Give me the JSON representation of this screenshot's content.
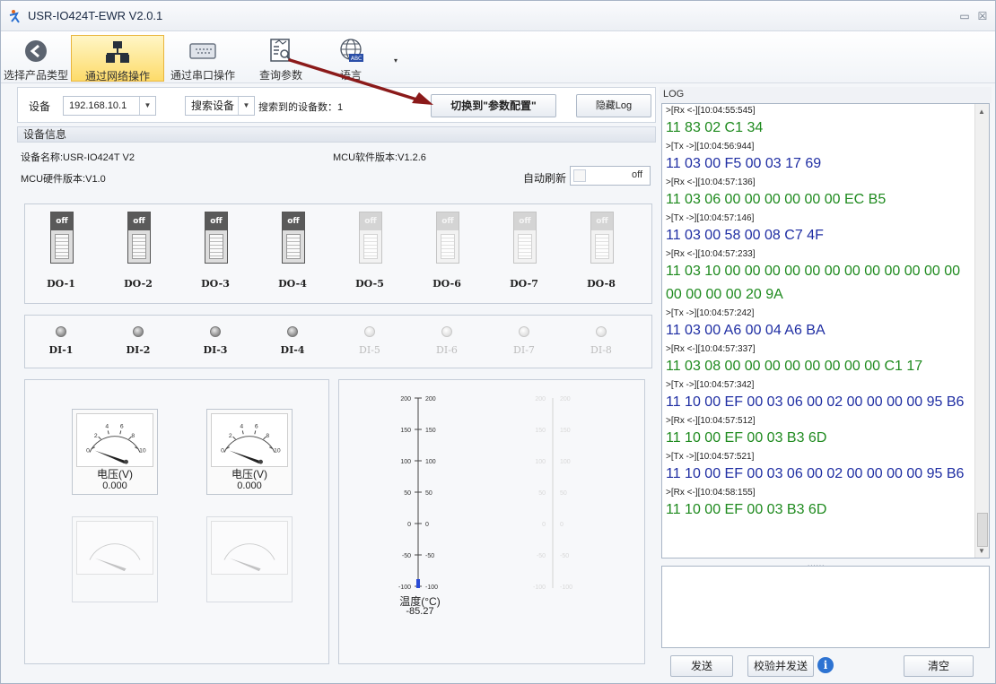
{
  "window": {
    "title": "USR-IO424T-EWR V2.0.1",
    "minimize": "▭",
    "close": "☒"
  },
  "toolbar": {
    "items": [
      {
        "label": "选择产品类型",
        "icon": "back-arrow-icon"
      },
      {
        "label": "通过网络操作",
        "icon": "network-icon",
        "active": true
      },
      {
        "label": "通过串口操作",
        "icon": "serial-port-icon"
      },
      {
        "label": "查询参数",
        "icon": "query-params-icon"
      },
      {
        "label": "语言",
        "icon": "globe-language-icon"
      }
    ],
    "dropdown": "▾"
  },
  "device_bar": {
    "device_label": "设备",
    "device_value": "192.168.10.1",
    "search_button": "搜索设备",
    "found_label": "搜索到的设备数：1",
    "switch_button": "切换到\"参数配置\"",
    "hide_log_button": "隐藏Log"
  },
  "device_info": {
    "section_title": "设备信息",
    "name": "设备名称:USR-IO424T V2",
    "mcu_software": "MCU软件版本:V1.2.6",
    "mcu_hardware": "MCU硬件版本:V1.0",
    "auto_refresh_label": "自动刷新",
    "auto_refresh_state": "off"
  },
  "digital_outputs": [
    {
      "label": "DO-1",
      "state": "off",
      "enabled": true
    },
    {
      "label": "DO-2",
      "state": "off",
      "enabled": true
    },
    {
      "label": "DO-3",
      "state": "off",
      "enabled": true
    },
    {
      "label": "DO-4",
      "state": "off",
      "enabled": true
    },
    {
      "label": "DO-5",
      "state": "off",
      "enabled": false
    },
    {
      "label": "DO-6",
      "state": "off",
      "enabled": false
    },
    {
      "label": "DO-7",
      "state": "off",
      "enabled": false
    },
    {
      "label": "DO-8",
      "state": "off",
      "enabled": false
    }
  ],
  "digital_inputs": [
    {
      "label": "DI-1",
      "enabled": true
    },
    {
      "label": "DI-2",
      "enabled": true
    },
    {
      "label": "DI-3",
      "enabled": true
    },
    {
      "label": "DI-4",
      "enabled": true
    },
    {
      "label": "DI-5",
      "enabled": false
    },
    {
      "label": "DI-6",
      "enabled": false
    },
    {
      "label": "DI-7",
      "enabled": false
    },
    {
      "label": "DI-8",
      "enabled": false
    }
  ],
  "gauges": [
    {
      "label": "电压(V)",
      "value": "0.000",
      "enabled": true
    },
    {
      "label": "电压(V)",
      "value": "0.000",
      "enabled": true
    },
    {
      "label": "",
      "value": "",
      "enabled": false
    },
    {
      "label": "",
      "value": "",
      "enabled": false
    }
  ],
  "gauge_scale": [
    "0",
    "2",
    "4",
    "6",
    "8",
    "10"
  ],
  "thermometer": {
    "label": "温度(°C)",
    "value": "-85.27",
    "ticks": [
      "200",
      "150",
      "100",
      "50",
      "0",
      "-50",
      "-100"
    ]
  },
  "log": {
    "title": "LOG",
    "lines": [
      {
        "kind": "meta",
        "text": ">[Rx <-][10:04:55:545]"
      },
      {
        "kind": "rx",
        "text": "11 83 02 C1 34"
      },
      {
        "kind": "meta",
        "text": ">[Tx ->][10:04:56:944]"
      },
      {
        "kind": "tx",
        "text": "11 03 00 F5 00 03 17 69"
      },
      {
        "kind": "meta",
        "text": ">[Rx <-][10:04:57:136]"
      },
      {
        "kind": "rx",
        "text": "11 03 06 00 00 00 00 00 00 EC B5"
      },
      {
        "kind": "meta",
        "text": ">[Tx ->][10:04:57:146]"
      },
      {
        "kind": "tx",
        "text": "11 03 00 58 00 08 C7 4F"
      },
      {
        "kind": "meta",
        "text": ">[Rx <-][10:04:57:233]"
      },
      {
        "kind": "rx",
        "text": "11 03 10 00 00 00 00 00 00 00 00 00 00 00 00"
      },
      {
        "kind": "rx",
        "text": "00 00 00 00 20 9A"
      },
      {
        "kind": "meta",
        "text": ">[Tx ->][10:04:57:242]"
      },
      {
        "kind": "tx",
        "text": "11 03 00 A6 00 04 A6 BA"
      },
      {
        "kind": "meta",
        "text": ">[Rx <-][10:04:57:337]"
      },
      {
        "kind": "rx",
        "text": "11 03 08 00 00 00 00 00 00 00 00 C1 17"
      },
      {
        "kind": "meta",
        "text": ">[Tx ->][10:04:57:342]"
      },
      {
        "kind": "tx",
        "text": "11 10 00 EF 00 03 06 00 02 00 00 00 00 95 B6"
      },
      {
        "kind": "meta",
        "text": ">[Rx <-][10:04:57:512]"
      },
      {
        "kind": "rx",
        "text": "11 10 00 EF 00 03 B3 6D"
      },
      {
        "kind": "meta",
        "text": ">[Tx ->][10:04:57:521]"
      },
      {
        "kind": "tx",
        "text": "11 10 00 EF 00 03 06 00 02 00 00 00 00 95 B6"
      },
      {
        "kind": "meta",
        "text": ">[Rx <-][10:04:58:155]"
      },
      {
        "kind": "rx",
        "text": "11 10 00 EF 00 03 B3 6D"
      }
    ],
    "splitter": "......",
    "send_button": "发送",
    "check_send_button": "校验并发送",
    "info_glyph": "i",
    "clear_button": "清空"
  },
  "colors": {
    "rx": "#1e8a1e",
    "tx": "#1f2ea3",
    "annotation_arrow": "#8b1a1a",
    "active_tab": "#fddb6a"
  }
}
